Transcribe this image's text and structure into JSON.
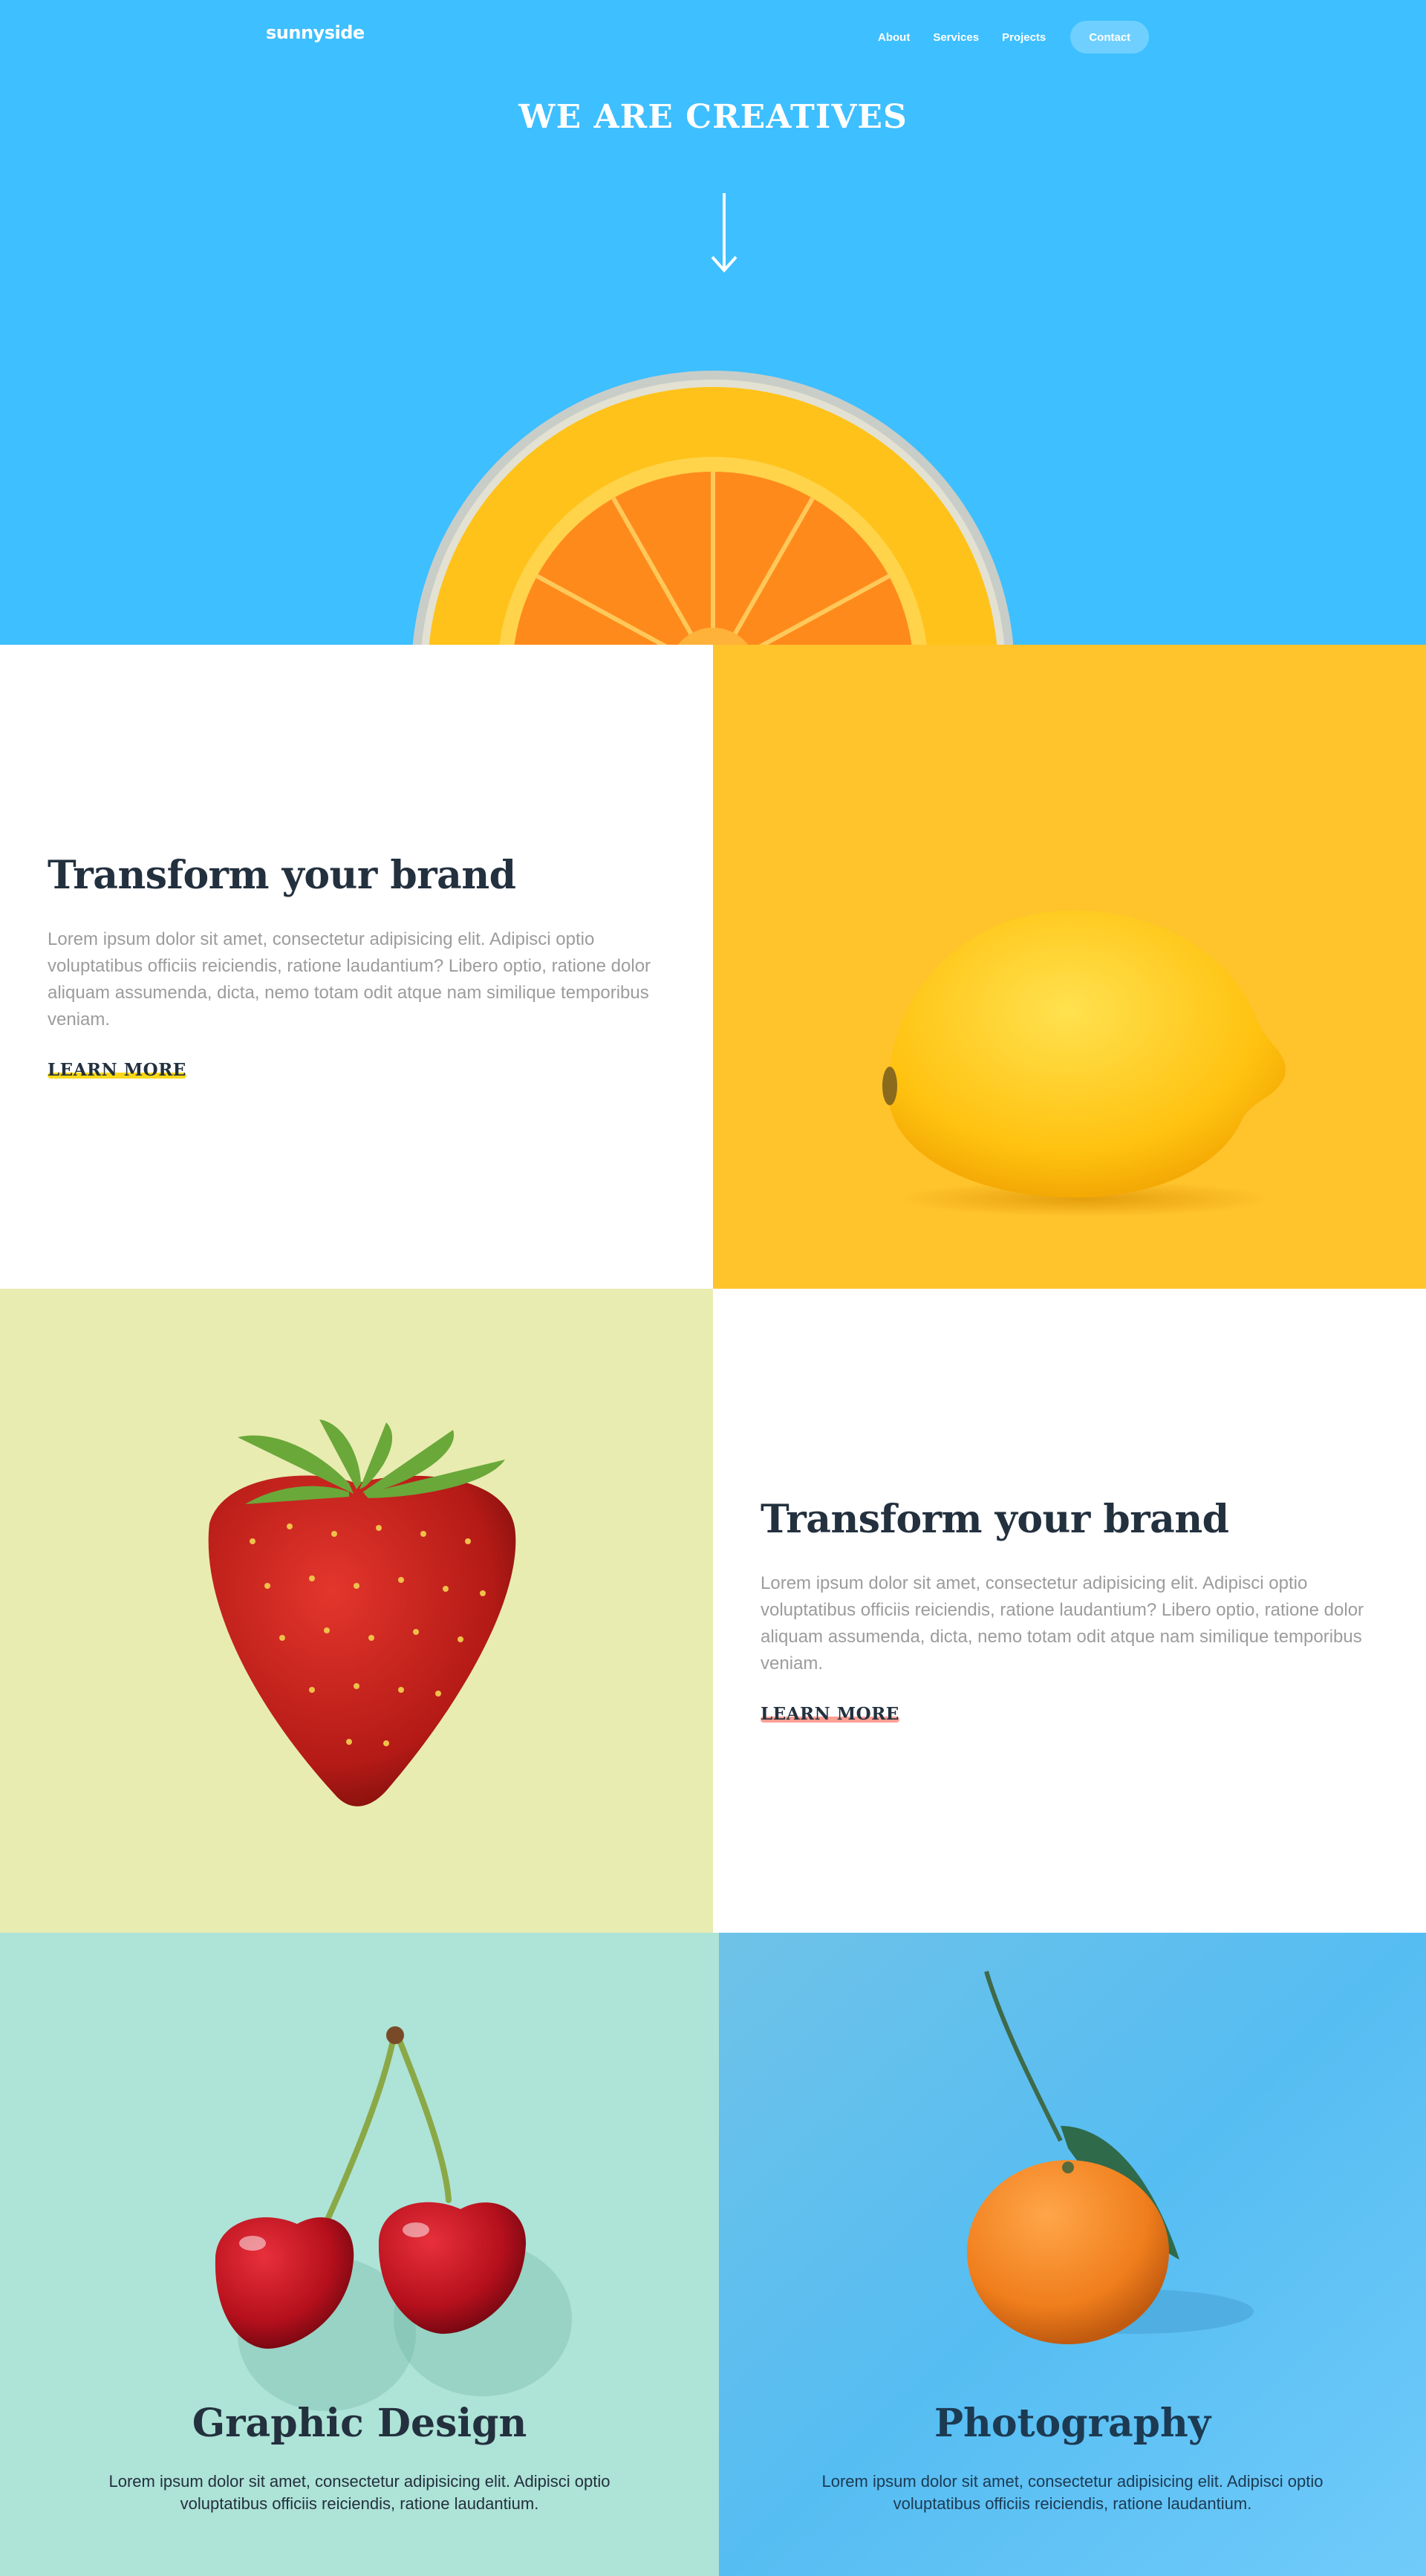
{
  "brand": {
    "logo": "sunnyside",
    "colors": {
      "hero_bg": "#3ebfff",
      "dark_text": "#23303e",
      "muted_text": "#9c9c9c",
      "lemon_bg": "#ffc32c",
      "strawberry_bg": "#e9ecb1",
      "graphic_design_bg": "#aee3d7",
      "photography_bg": "#62c0ec",
      "underline_yellow": "#fad400",
      "underline_pink": "#fe7766"
    }
  },
  "nav": {
    "items": [
      {
        "label": "About"
      },
      {
        "label": "Services"
      },
      {
        "label": "Projects"
      }
    ],
    "contact_label": "Contact"
  },
  "hero": {
    "title": "WE ARE CREATIVES",
    "arrow_icon": "arrow-down-icon"
  },
  "features": [
    {
      "title": "Transform your brand",
      "body": "Lorem ipsum dolor sit amet, consectetur adipisicing elit. Adipisci optio voluptatibus officiis reiciendis, ratione laudantium? Libero optio, ratione dolor aliquam assumenda, dicta, nemo totam odit atque nam similique temporibus veniam.",
      "link": "LEARN MORE",
      "image": "lemon-image"
    },
    {
      "title": "Transform your brand",
      "body": "Lorem ipsum dolor sit amet, consectetur adipisicing elit. Adipisci optio voluptatibus officiis reiciendis, ratione laudantium? Libero optio, ratione dolor aliquam assumenda, dicta, nemo totam odit atque nam similique temporibus veniam.",
      "link": "LEARN MORE",
      "image": "strawberry-image"
    }
  ],
  "services": [
    {
      "title": "Graphic Design",
      "body": "Lorem ipsum dolor sit amet, consectetur adipisicing elit. Adipisci optio voluptatibus officiis reiciendis, ratione laudantium.",
      "image": "cherries-image"
    },
    {
      "title": "Photography",
      "body": "Lorem ipsum dolor sit amet, consectetur adipisicing elit. Adipisci optio voluptatibus officiis reiciendis, ratione laudantium.",
      "image": "orange-image"
    }
  ]
}
